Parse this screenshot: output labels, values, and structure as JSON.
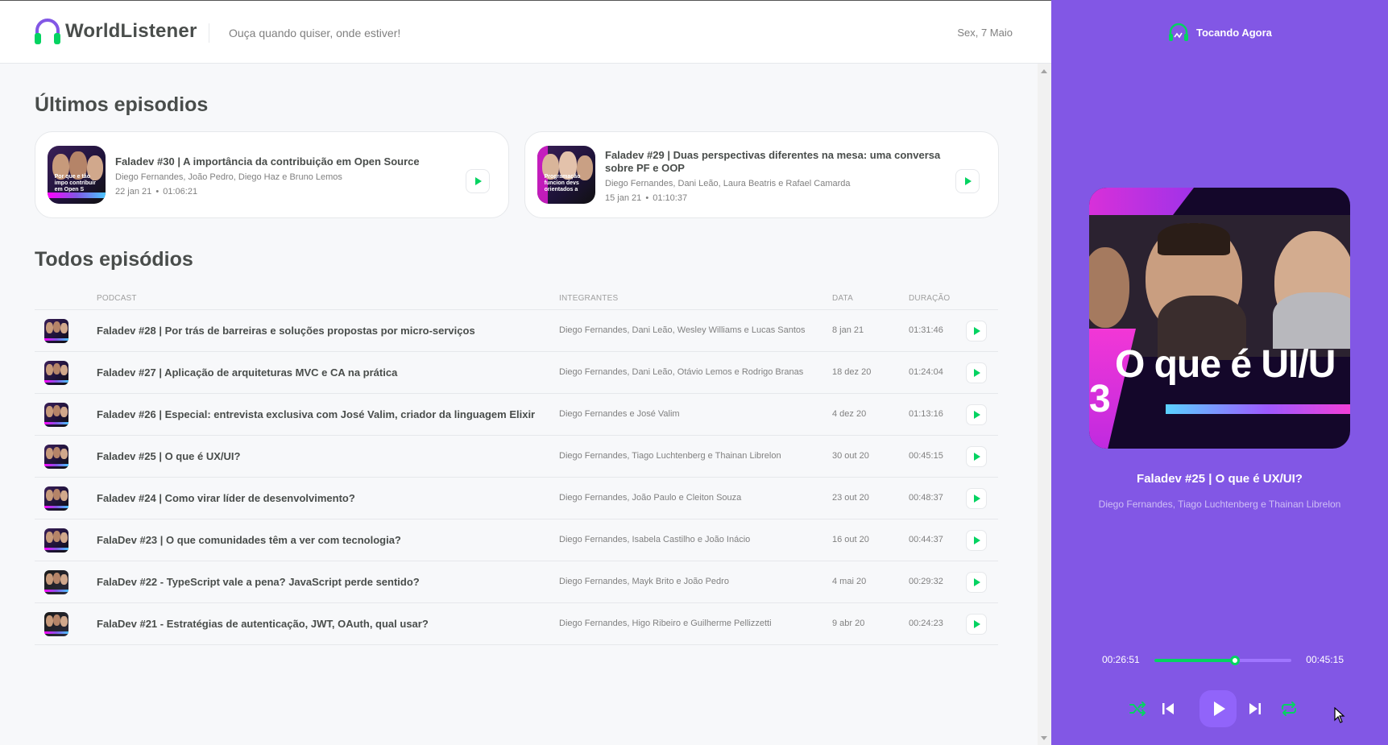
{
  "header": {
    "app_name": "WorldListener",
    "tagline": "Ouça quando quiser, onde estiver!",
    "date": "Sex, 7 Maio"
  },
  "latest": {
    "title": "Últimos episodios",
    "episodes": [
      {
        "title": "Faladev #30 | A importância da contribuição em Open Source",
        "members": "Diego Fernandes, João Pedro, Diego Haz e Bruno Lemos",
        "date": "22 jan 21",
        "dot": "•",
        "duration": "01:06:21",
        "thumb_caption": "Por que e tão impo contribuir em Open S"
      },
      {
        "title": "Faladev #29 | Duas perspectivas diferentes na mesa: uma conversa sobre PF e OOP",
        "members": "Diego Fernandes, Dani Leão, Laura Beatris e Rafael Camarda",
        "date": "15 jan 21",
        "dot": "•",
        "duration": "01:10:37",
        "thumb_caption": "Programação funcion devs orientados a"
      }
    ]
  },
  "all": {
    "title": "Todos episódios",
    "columns": [
      "Podcast",
      "Integrantes",
      "Data",
      "Duração"
    ],
    "episodes": [
      {
        "title": "Faladev #28 | Por trás de barreiras e soluções propostas por micro-serviços",
        "members": "Diego Fernandes, Dani Leão, Wesley Williams e Lucas Santos",
        "date": "8 jan 21",
        "duration": "01:31:46"
      },
      {
        "title": "Faladev #27 | Aplicação de arquiteturas MVC e CA na prática",
        "members": "Diego Fernandes, Dani Leão, Otávio Lemos e Rodrigo Branas",
        "date": "18 dez 20",
        "duration": "01:24:04"
      },
      {
        "title": "Faladev #26 | Especial: entrevista exclusiva com José Valim, criador da linguagem Elixir",
        "members": "Diego Fernandes e José Valim",
        "date": "4 dez 20",
        "duration": "01:13:16"
      },
      {
        "title": "Faladev #25 | O que é UX/UI?",
        "members": "Diego Fernandes, Tiago Luchtenberg e Thainan Librelon",
        "date": "30 out 20",
        "duration": "00:45:15"
      },
      {
        "title": "Faladev #24 | Como virar líder de desenvolvimento?",
        "members": "Diego Fernandes, João Paulo e Cleiton Souza",
        "date": "23 out 20",
        "duration": "00:48:37"
      },
      {
        "title": "FalaDev #23 | O que comunidades têm a ver com tecnologia?",
        "members": "Diego Fernandes, Isabela Castilho e João Inácio",
        "date": "16 out 20",
        "duration": "00:44:37"
      },
      {
        "title": "FalaDev #22 - TypeScript vale a pena? JavaScript perde sentido?",
        "members": "Diego Fernandes, Mayk Brito e João Pedro",
        "date": "4 mai 20",
        "duration": "00:29:32"
      },
      {
        "title": "FalaDev #21 - Estratégias de autenticação, JWT, OAuth, qual usar?",
        "members": "Diego Fernandes, Higo Ribeiro e Guilherme Pellizzetti",
        "date": "9 abr 20",
        "duration": "00:24:23"
      }
    ]
  },
  "player": {
    "heading": "Tocando Agora",
    "cover_text": "O que é UI/U",
    "cover_number": "3",
    "title": "Faladev #25 | O que é UX/UI?",
    "members": "Diego Fernandes, Tiago Luchtenberg e Thainan Librelon",
    "current_time": "00:26:51",
    "total_time": "00:45:15",
    "progress_fraction": 0.59,
    "controls": [
      "shuffle-icon",
      "previous-icon",
      "play-icon",
      "next-icon",
      "repeat-icon"
    ]
  },
  "colors": {
    "accent_purple": "#8257e5",
    "accent_green": "#04d361",
    "text": "#494d4b",
    "muted": "#808080"
  }
}
